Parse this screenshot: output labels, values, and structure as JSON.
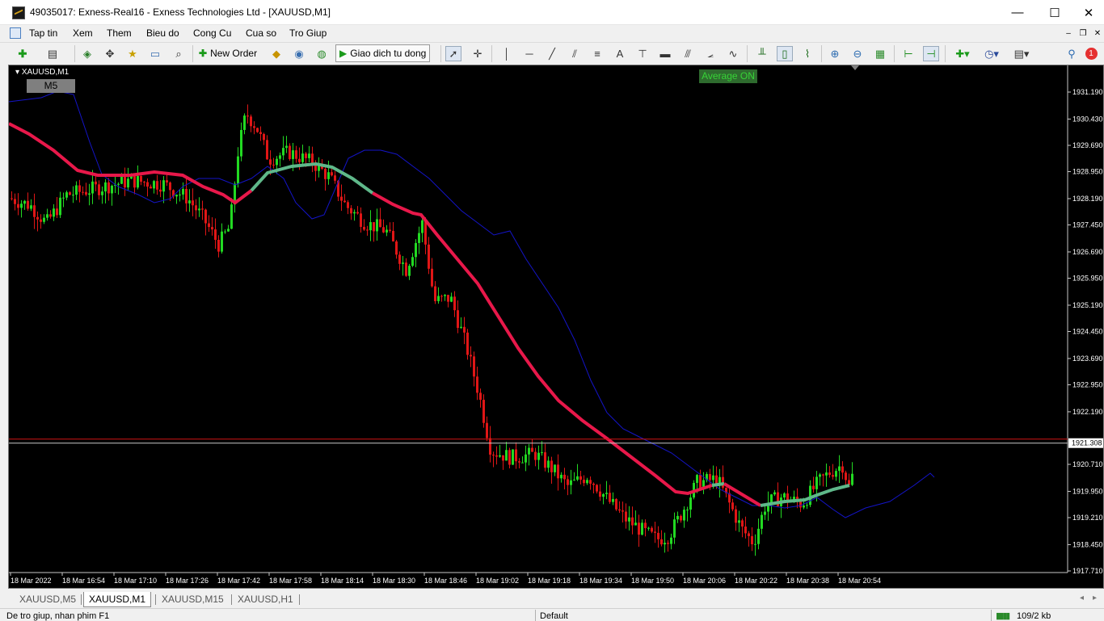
{
  "window": {
    "title": "49035017: Exness-Real16 - Exness Technologies Ltd - [XAUUSD,M1]",
    "minimize_glyph": "—",
    "maximize_glyph": "☐",
    "close_glyph": "✕"
  },
  "menu": {
    "items": [
      "Tap tin",
      "Xem",
      "Them",
      "Bieu do",
      "Cong Cu",
      "Cua so",
      "Tro Giup"
    ],
    "mdi_minimize": "–",
    "mdi_restore": "❐",
    "mdi_close": "✕"
  },
  "toolbar": {
    "new_order_label": "New Order",
    "autotrade_label": "Giao dich tu dong",
    "notification_count": "1",
    "icons": [
      "new-chart-icon",
      "profiles-icon",
      "market-watch-icon",
      "navigator-icon",
      "favorites-icon",
      "terminal-icon",
      "strategy-tester-icon",
      "new-order-icon",
      "metaeditor-icon",
      "signals-icon",
      "market-icon",
      "autotrading-icon",
      "cursor-icon",
      "crosshair-icon",
      "vertical-line-icon",
      "horizontal-line-icon",
      "trendline-icon",
      "equidistant-channel-icon",
      "fibonacci-icon",
      "text-icon",
      "text-label-icon",
      "rectangle-icon",
      "andrews-pitchfork-icon",
      "gann-fan-icon",
      "elliott-wave-icon",
      "bar-chart-icon",
      "candlestick-icon",
      "line-chart-icon",
      "zoom-in-icon",
      "zoom-out-icon",
      "tile-windows-icon",
      "chart-shift-icon",
      "autoscroll-icon",
      "indicators-icon",
      "periods-icon",
      "templates-icon",
      "search-icon",
      "notification-icon"
    ]
  },
  "chart": {
    "symbol": "XAUUSD,M1",
    "timeframe_badge": "M5",
    "average_badge": "Average ON",
    "current_price": "1921.308",
    "price_labels": [
      "1931.190",
      "1930.430",
      "1929.690",
      "1928.950",
      "1928.190",
      "1927.450",
      "1926.690",
      "1925.950",
      "1925.190",
      "1924.450",
      "1923.690",
      "1922.950",
      "1922.190",
      "1920.710",
      "1919.950",
      "1919.210",
      "1918.450",
      "1917.710"
    ],
    "time_labels": [
      "18 Mar 2022",
      "18 Mar 16:54",
      "18 Mar 17:10",
      "18 Mar 17:26",
      "18 Mar 17:42",
      "18 Mar 17:58",
      "18 Mar 18:14",
      "18 Mar 18:30",
      "18 Mar 18:46",
      "18 Mar 19:02",
      "18 Mar 19:18",
      "18 Mar 19:34",
      "18 Mar 19:50",
      "18 Mar 20:06",
      "18 Mar 20:22",
      "18 Mar 20:38",
      "18 Mar 20:54"
    ],
    "colors": {
      "background": "#000000",
      "bull": "#22d922",
      "bear": "#e01616",
      "ma_red": "#e8184a",
      "ma_green": "#5fb88a",
      "envelope": "#1414c8",
      "ask_line": "#d21414",
      "bid_line": "#c8c8c8"
    }
  },
  "tabs": [
    "XAUUSD,M5",
    "XAUUSD,M1",
    "XAUUSD,M15",
    "XAUUSD,H1"
  ],
  "active_tab": "XAUUSD,M1",
  "status": {
    "help_text": "De tro giup, nhan phim F1",
    "profile": "Default",
    "traffic": "109/2 kb"
  }
}
